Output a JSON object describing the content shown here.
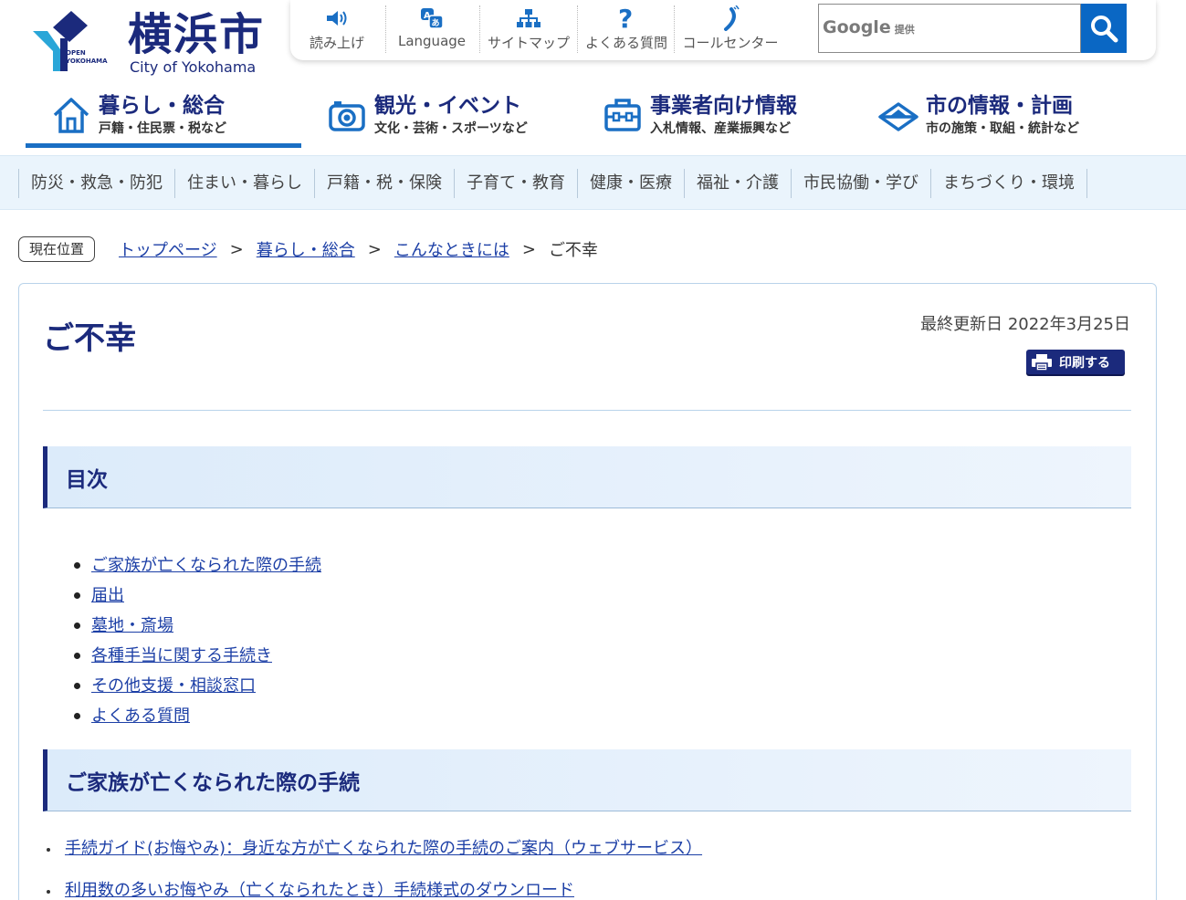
{
  "header": {
    "logo_kanji": "横浜市",
    "logo_en": "City of Yokohama",
    "logo_mark_text": [
      "OPEN",
      "YOKOHAMA"
    ]
  },
  "utility": {
    "items": [
      {
        "label": "読み上げ",
        "icon": "speaker-icon"
      },
      {
        "label": "Language",
        "icon": "translate-icon"
      },
      {
        "label": "サイトマップ",
        "icon": "sitemap-icon"
      },
      {
        "label": "よくある質問",
        "icon": "question-icon"
      },
      {
        "label": "コールセンター",
        "icon": "phone-icon"
      }
    ],
    "search": {
      "brand": "Google",
      "brand_suffix": "提供"
    }
  },
  "main_nav": {
    "items": [
      {
        "title": "暮らし・総合",
        "sub": "戸籍・住民票・税など",
        "icon": "house-icon"
      },
      {
        "title": "観光・イベント",
        "sub": "文化・芸術・スポーツなど",
        "icon": "camera-icon"
      },
      {
        "title": "事業者向け情報",
        "sub": "入札情報、産業振興など",
        "icon": "briefcase-icon"
      },
      {
        "title": "市の情報・計画",
        "sub": "市の施策・取組・統計など",
        "icon": "city-emblem-icon"
      }
    ]
  },
  "categories": [
    "防災・救急・防犯",
    "住まい・暮らし",
    "戸籍・税・保険",
    "子育て・教育",
    "健康・医療",
    "福祉・介護",
    "市民協働・学び",
    "まちづくり・環境"
  ],
  "breadcrumb": {
    "label": "現在位置",
    "links": [
      "トップページ",
      "暮らし・総合",
      "こんなときには"
    ],
    "separator": ">",
    "current": "ご不幸"
  },
  "page": {
    "title": "ご不幸",
    "updated": "最終更新日 2022年3月25日",
    "print_label": "印刷する",
    "toc_heading": "目次",
    "toc": [
      "ご家族が亡くなられた際の手続",
      "届出",
      "墓地・斎場",
      "各種手当に関する手続き",
      "その他支援・相談窓口",
      "よくある質問"
    ],
    "section1_heading": "ご家族が亡くなられた際の手続",
    "section1_links": [
      "手続ガイド(お悔やみ)：身近な方が亡くなられた際の手続のご案内（ウェブサービス）",
      "利用数の多いお悔やみ（亡くなられたとき）手続様式のダウンロード"
    ]
  },
  "colors": {
    "brand_navy": "#1b2a7c",
    "accent_blue": "#0a67c4",
    "link": "#1c3fa6",
    "category_bg": "#eaf4fc"
  }
}
